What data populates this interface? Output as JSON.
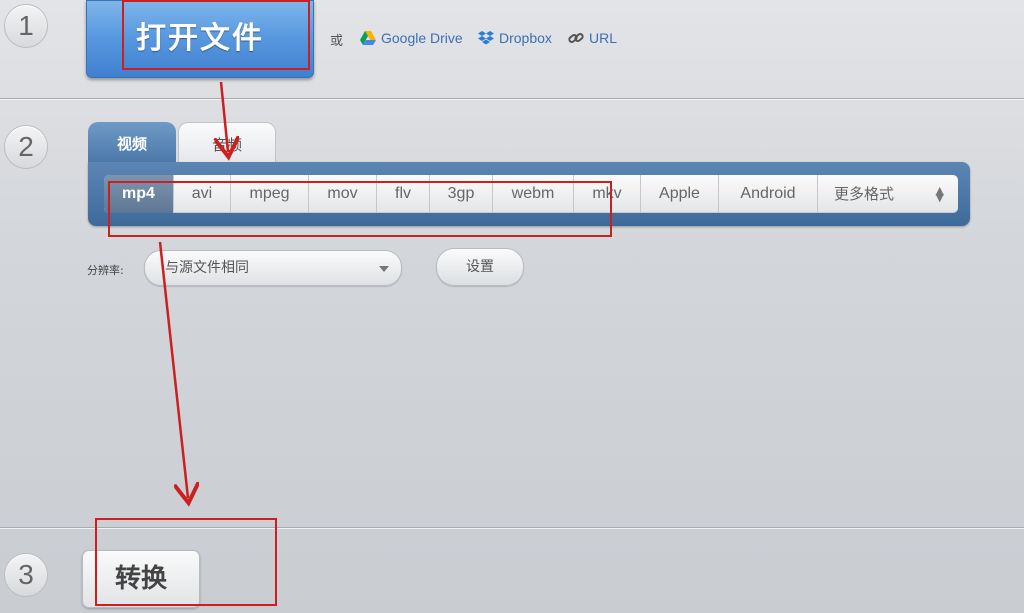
{
  "steps": [
    "1",
    "2",
    "3"
  ],
  "step1": {
    "open_file_label": "打开文件",
    "or_label": "或",
    "sources": [
      {
        "label": "Google Drive",
        "icon": "google-drive-icon"
      },
      {
        "label": "Dropbox",
        "icon": "dropbox-icon"
      },
      {
        "label": "URL",
        "icon": "link-icon"
      }
    ]
  },
  "step2": {
    "tabs": [
      {
        "label": "视频",
        "active": true
      },
      {
        "label": "音频",
        "active": false
      }
    ],
    "formats": [
      "mp4",
      "avi",
      "mpeg",
      "mov",
      "flv",
      "3gp",
      "webm",
      "mkv",
      "Apple",
      "Android"
    ],
    "selected_format": "mp4",
    "more_formats_label": "更多格式",
    "resolution_label": "分辨率:",
    "resolution_value": "与源文件相同",
    "settings_label": "设置"
  },
  "step3": {
    "convert_label": "转换"
  },
  "colors": {
    "accent_blue": "#4a8ad8",
    "annotation_red": "#cc1f1f",
    "panel_blue": "#4a77a8"
  }
}
